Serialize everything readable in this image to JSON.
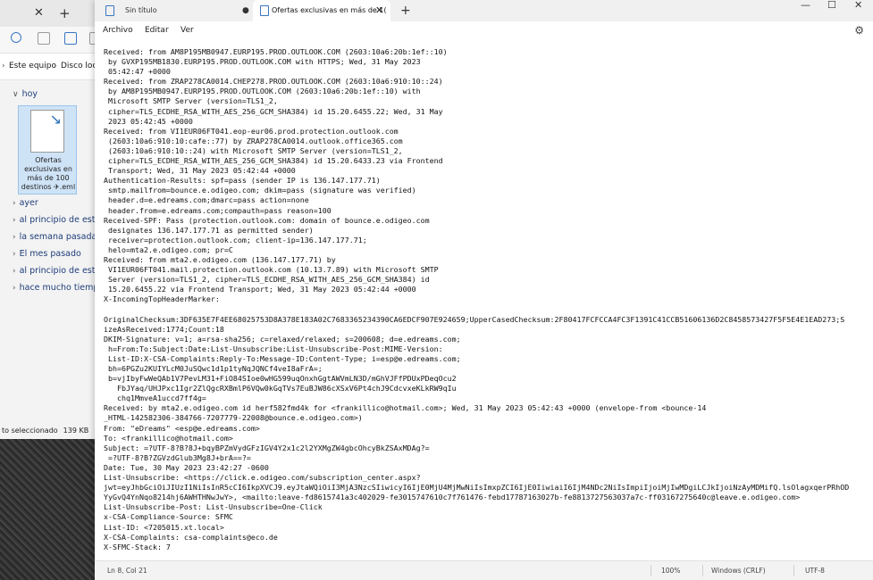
{
  "explorer": {
    "address": {
      "segment_1": "Este equipo",
      "segment_2": "Disco local"
    },
    "group_today": "hoy",
    "file": {
      "name": "Ofertas exclusivas en más de 100 destinos ✈.eml"
    },
    "groups": [
      "ayer",
      "al principio de esta",
      "la semana pasada",
      "El mes pasado",
      "al principio de este",
      "hace mucho tiempo"
    ],
    "status": {
      "selected": "to seleccionado",
      "size": "139 KB"
    }
  },
  "notepad": {
    "tabs": [
      {
        "label": "Sin título"
      },
      {
        "label": "Ofertas exclusivas en más de 1("
      }
    ],
    "menu": {
      "file": "Archivo",
      "edit": "Editar",
      "view": "Ver"
    },
    "status": {
      "position": "Ln 8, Col 21",
      "zoom": "100%",
      "line_endings": "Windows (CRLF)",
      "encoding": "UTF-8"
    },
    "lines": [
      "Received: from AM8P195MB0947.EURP195.PROD.OUTLOOK.COM (2603:10a6:20b:1ef::10)",
      " by GVXP195MB1830.EURP195.PROD.OUTLOOK.COM with HTTPS; Wed, 31 May 2023",
      " 05:42:47 +0000",
      "Received: from ZRAP278CA0014.CHEP278.PROD.OUTLOOK.COM (2603:10a6:910:10::24)",
      " by AM8P195MB0947.EURP195.PROD.OUTLOOK.COM (2603:10a6:20b:1ef::10) with",
      " Microsoft SMTP Server (version=TLS1_2,",
      " cipher=TLS_ECDHE_RSA_WITH_AES_256_GCM_SHA384) id 15.20.6455.22; Wed, 31 May",
      " 2023 05:42:45 +0000",
      "Received: from VI1EUR06FT041.eop-eur06.prod.protection.outlook.com",
      " (2603:10a6:910:10:cafe::77) by ZRAP278CA0014.outlook.office365.com",
      " (2603:10a6:910:10::24) with Microsoft SMTP Server (version=TLS1_2,",
      " cipher=TLS_ECDHE_RSA_WITH_AES_256_GCM_SHA384) id 15.20.6433.23 via Frontend",
      " Transport; Wed, 31 May 2023 05:42:44 +0000",
      "Authentication-Results: spf=pass (sender IP is 136.147.177.71)",
      " smtp.mailfrom=bounce.e.odigeo.com; dkim=pass (signature was verified)",
      " header.d=e.edreams.com;dmarc=pass action=none",
      " header.from=e.edreams.com;compauth=pass reason=100",
      "Received-SPF: Pass (protection.outlook.com: domain of bounce.e.odigeo.com",
      " designates 136.147.177.71 as permitted sender)",
      " receiver=protection.outlook.com; client-ip=136.147.177.71;",
      " helo=mta2.e.odigeo.com; pr=C",
      "Received: from mta2.e.odigeo.com (136.147.177.71) by",
      " VI1EUR06FT041.mail.protection.outlook.com (10.13.7.89) with Microsoft SMTP",
      " Server (version=TLS1_2, cipher=TLS_ECDHE_RSA_WITH_AES_256_GCM_SHA384) id",
      " 15.20.6455.22 via Frontend Transport; Wed, 31 May 2023 05:42:44 +0000",
      "X-IncomingTopHeaderMarker:",
      "",
      "OriginalChecksum:3DF635E7F4EE68025753D8A378E183A02C7683365234390CA6EDCF907E924659;UpperCasedChecksum:2F80417FCFCCA4FC3F1391C41CCB51606136D2C8458573427F5F5E4E1EAD273;S",
      "izeAsReceived:1774;Count:18",
      "DKIM-Signature: v=1; a=rsa-sha256; c=relaxed/relaxed; s=200608; d=e.edreams.com;",
      " h=From:To:Subject:Date:List-Unsubscribe:List-Unsubscribe-Post:MIME-Version:",
      " List-ID:X-CSA-Complaints:Reply-To:Message-ID:Content-Type; i=esp@e.edreams.com;",
      " bh=6PGZu2KUIYLcM0JuSQwc1d1p1tyNqJQNCf4veI8aFrA=;",
      " b=vjIbyFwWeQAb1V7PevLM31+FiO84SIoe0wHG599uqOnxhGgtAWVmLN3D/mGhVJFfPDUxPDeqOcu2",
      "   FbJYaq/UHJPxc1Igr2ZlQgcRXBmlP6VQw0kGqTVs7EuBJW86cXSxV6Pt4chJ9CdcvxeKLkRW9qIu",
      "   chq1MmveA1uccd7ff4g=",
      "Received: by mta2.e.odigeo.com id herf582fmd4k for <frankillico@hotmail.com>; Wed, 31 May 2023 05:42:43 +0000 (envelope-from <bounce-14",
      "_HTML-142582306-384766-7207779-22008@bounce.e.odigeo.com>)",
      "From: \"eDreams\" <esp@e.edreams.com>",
      "To: <frankillico@hotmail.com>",
      "Subject: =?UTF-8?B?8J+bqyBPZmVydGFzIGV4Y2x1c2l2YXMgZW4gbcOhcyBkZSAxMDAg?=",
      " =?UTF-8?B?ZGVzdGlub3Mg8J+brA==?=",
      "Date: Tue, 30 May 2023 23:42:27 -0600",
      "List-Unsubscribe: <https://click.e.odigeo.com/subscription_center.aspx?",
      "jwt=eyJhbGciOiJIUzI1NiIsInR5cCI6IkpXVCJ9.eyJtaWQiOiI3MjA3NzcSIiwicyI6IjE0MjU4MjMwNiIsImxpZCI6IjE0IiwiaiI6IjM4NDc2NiIsImpiIjoiMjIwMDgiLCJkIjoiNzAyMDMifQ.lsOlagxqerPRhOD",
      "YyGvQ4YnNqo8214hj6AWHTHNwJwY>, <mailto:leave-fd8615741a3c402029-fe3015747610c7f761476-febd17787163027b-fe8813727563037a7c-ff03167275640c@leave.e.odigeo.com>",
      "List-Unsubscribe-Post: List-Unsubscribe=One-Click",
      "x-CSA-Compliance-Source: SFMC",
      "List-ID: <7205015.xt.local>",
      "X-CSA-Complaints: csa-complaints@eco.de",
      "X-SFMC-Stack: 7"
    ]
  }
}
